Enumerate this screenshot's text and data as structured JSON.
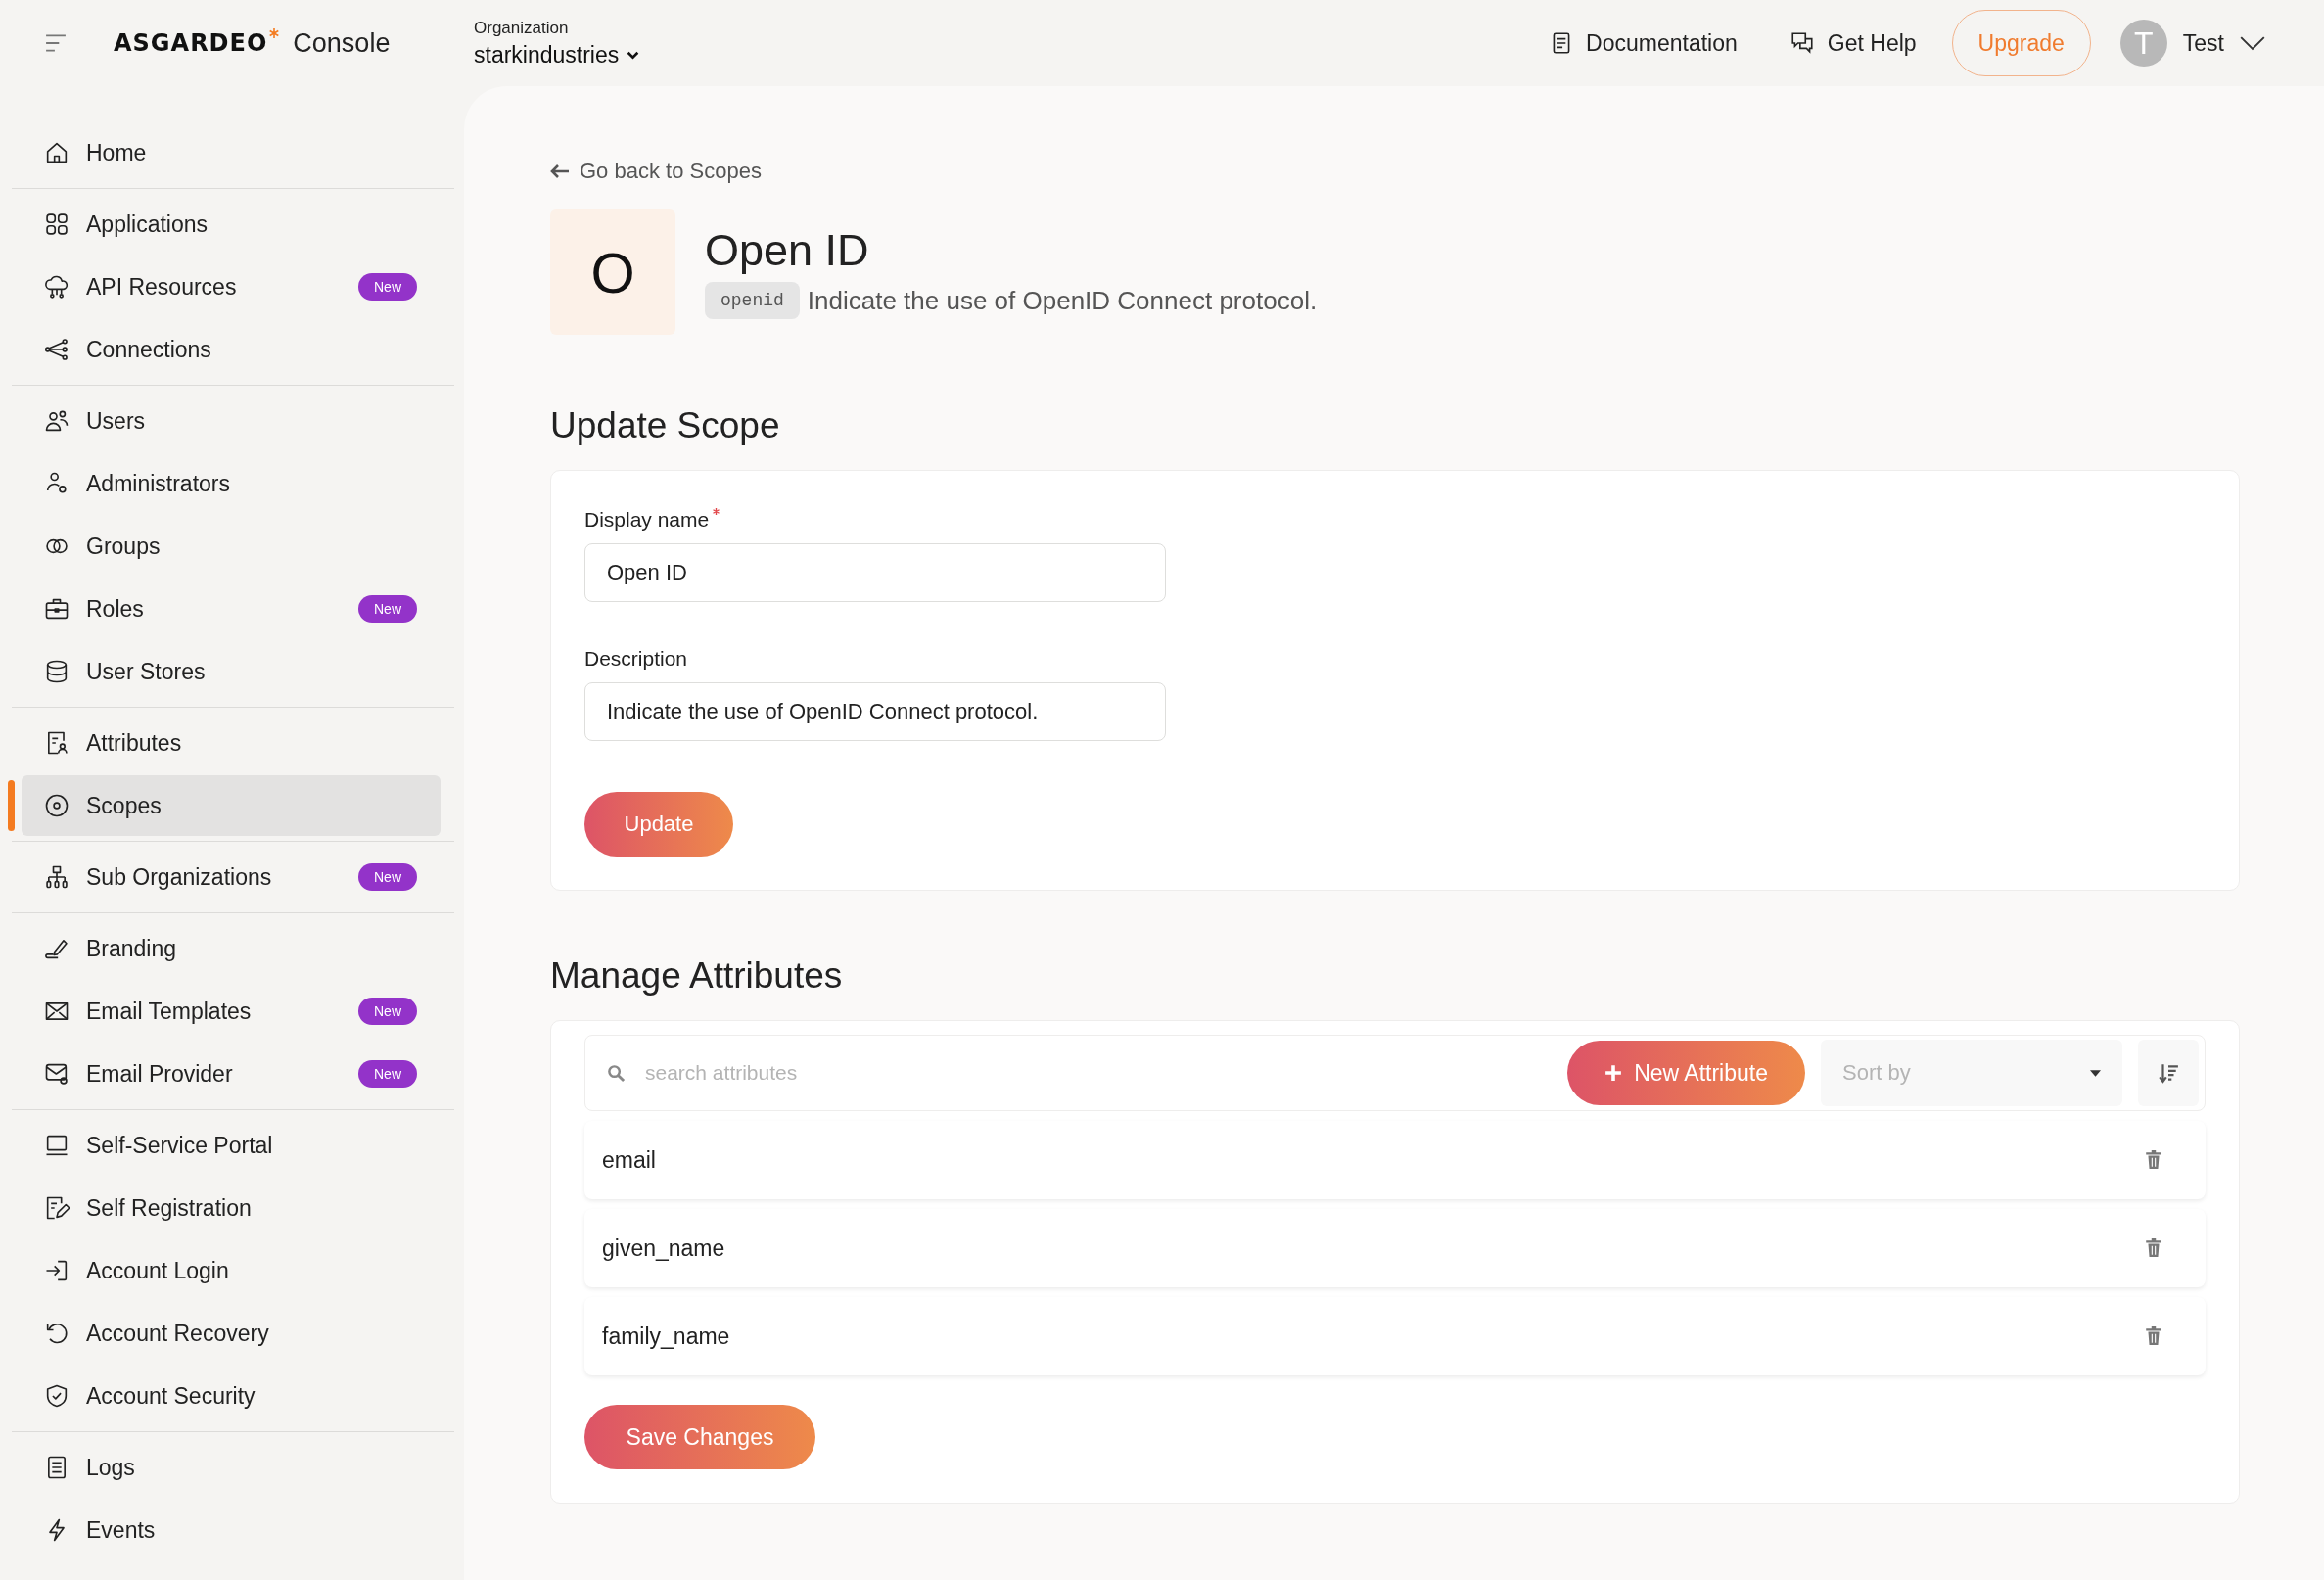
{
  "header": {
    "logo_text": "ASGARDEO",
    "product": "Console",
    "org_label": "Organization",
    "org_name": "starkindustries",
    "links": [
      {
        "label": "Documentation"
      },
      {
        "label": "Get Help"
      }
    ],
    "upgrade": "Upgrade",
    "user": {
      "initial": "T",
      "name": "Test"
    }
  },
  "sidebar": {
    "groups": [
      {
        "items": [
          {
            "label": "Home",
            "selected": false
          }
        ]
      },
      {
        "items": [
          {
            "label": "Applications",
            "selected": false
          },
          {
            "label": "API Resources",
            "badge": "New",
            "selected": false
          },
          {
            "label": "Connections",
            "selected": false
          }
        ]
      },
      {
        "items": [
          {
            "label": "Users",
            "selected": false
          },
          {
            "label": "Administrators",
            "selected": false
          },
          {
            "label": "Groups",
            "selected": false
          },
          {
            "label": "Roles",
            "badge": "New",
            "selected": false
          },
          {
            "label": "User Stores",
            "selected": false
          }
        ]
      },
      {
        "items": [
          {
            "label": "Attributes",
            "selected": false
          },
          {
            "label": "Scopes",
            "selected": true
          }
        ]
      },
      {
        "items": [
          {
            "label": "Sub Organizations",
            "badge": "New",
            "selected": false
          }
        ]
      },
      {
        "items": [
          {
            "label": "Branding",
            "selected": false
          },
          {
            "label": "Email Templates",
            "badge": "New",
            "selected": false
          },
          {
            "label": "Email Provider",
            "badge": "New",
            "selected": false
          }
        ]
      },
      {
        "items": [
          {
            "label": "Self-Service Portal",
            "selected": false
          },
          {
            "label": "Self Registration",
            "selected": false
          },
          {
            "label": "Account Login",
            "selected": false
          },
          {
            "label": "Account Recovery",
            "selected": false
          },
          {
            "label": "Account Security",
            "selected": false
          }
        ]
      },
      {
        "items": [
          {
            "label": "Logs",
            "selected": false
          },
          {
            "label": "Events",
            "selected": false
          }
        ]
      }
    ]
  },
  "main": {
    "back_link": "Go back to Scopes",
    "scope": {
      "initial": "O",
      "name": "Open ID",
      "identifier": "openid",
      "description": "Indicate the use of OpenID Connect protocol."
    },
    "update_section": {
      "title": "Update Scope",
      "fields": [
        {
          "label": "Display name",
          "required": true,
          "value": "Open ID"
        },
        {
          "label": "Description",
          "required": false,
          "value": "Indicate the use of OpenID Connect protocol."
        }
      ],
      "button": "Update"
    },
    "attributes_section": {
      "title": "Manage Attributes",
      "search": {
        "placeholder": "search attributes"
      },
      "new_button": "New Attribute",
      "sort": {
        "placeholder": "Sort by"
      },
      "rows": [
        {
          "name": "email"
        },
        {
          "name": "given_name"
        },
        {
          "name": "family_name"
        }
      ],
      "save_button": "Save Changes"
    }
  }
}
